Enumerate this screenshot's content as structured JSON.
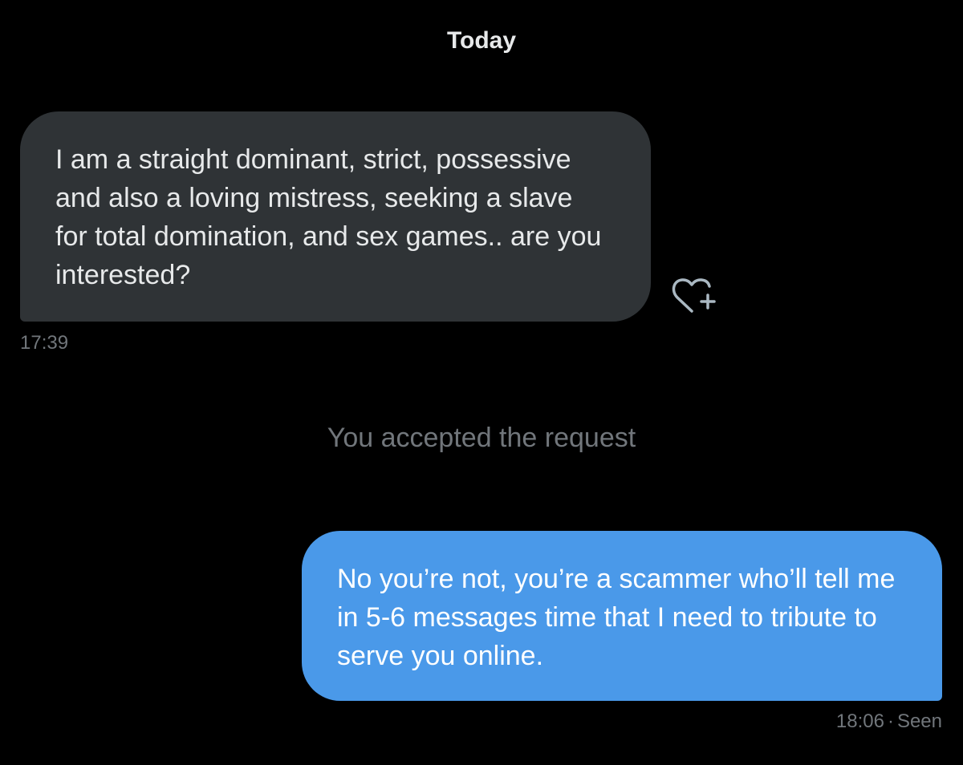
{
  "conversation": {
    "date_header": "Today",
    "messages": [
      {
        "direction": "incoming",
        "text": "I am a straight dominant, strict, possessive and also a loving mistress, seeking a slave  for total domination, and sex games.. are you interested?",
        "time": "17:39",
        "reaction_icon": "heart-plus-icon"
      },
      {
        "direction": "outgoing",
        "text": "No you’re not, you’re a scammer who’ll tell me in 5-6 messages time that I need to tribute to serve you online.",
        "time": "18:06",
        "status": "Seen"
      }
    ],
    "system_note": "You accepted the request"
  },
  "colors": {
    "background": "#000000",
    "incoming_bubble": "#2f3336",
    "outgoing_bubble": "#4a99e9",
    "muted_text": "#71767b",
    "primary_text": "#e7e9ea"
  }
}
